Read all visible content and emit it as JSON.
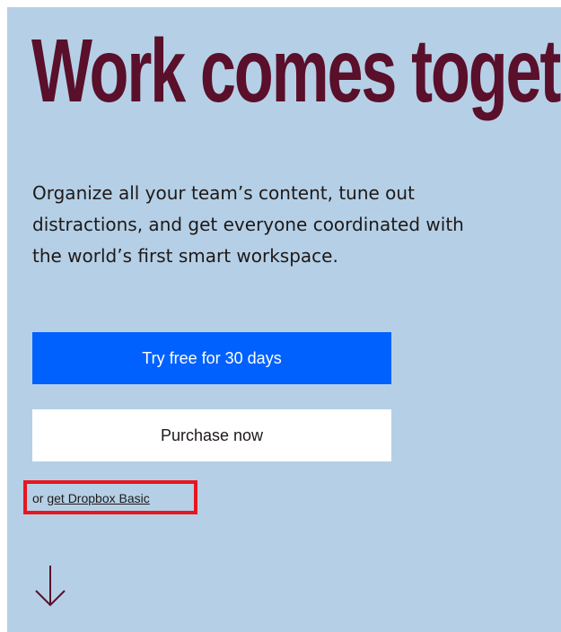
{
  "hero": {
    "title": "Work comes together here",
    "description": "Organize all your team’s content, tune out distractions, and get everyone coordinated with the world’s first smart workspace."
  },
  "cta": {
    "primary_label": "Try free for 30 days",
    "secondary_label": "Purchase now",
    "basic_prefix": "or ",
    "basic_link": "get Dropbox Basic"
  },
  "icons": {
    "scroll": "arrow-down-icon"
  },
  "colors": {
    "background": "#b5d0e6",
    "title": "#5a0f2a",
    "primary": "#0061fe",
    "highlight": "#e8151f"
  }
}
